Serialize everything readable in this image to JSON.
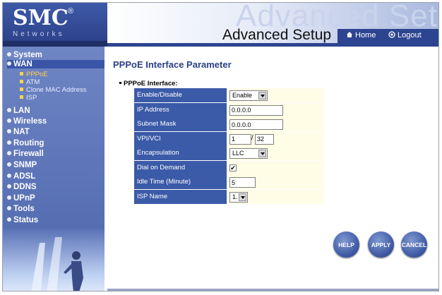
{
  "brand": {
    "logo": "SMC",
    "registered_mark": "®",
    "subtitle": "Networks"
  },
  "banner": {
    "ghost_text": "Advanced Setup",
    "title": "Advanced Setup",
    "home_label": "Home",
    "logout_label": "Logout"
  },
  "sidebar": {
    "items": [
      {
        "label": "System"
      },
      {
        "label": "WAN",
        "active": true
      },
      {
        "label": "LAN"
      },
      {
        "label": "Wireless"
      },
      {
        "label": "NAT"
      },
      {
        "label": "Routing"
      },
      {
        "label": "Firewall"
      },
      {
        "label": "SNMP"
      },
      {
        "label": "ADSL"
      },
      {
        "label": "DDNS"
      },
      {
        "label": "UPnP"
      },
      {
        "label": "Tools"
      },
      {
        "label": "Status"
      }
    ],
    "wan_subitems": [
      {
        "label": "PPPoE",
        "active": true
      },
      {
        "label": "ATM"
      },
      {
        "label": "Clone MAC Address"
      },
      {
        "label": "ISP"
      }
    ]
  },
  "main": {
    "page_title": "PPPoE Interface Parameter",
    "section_label": "PPPoE Interface:",
    "fields": {
      "enable_disable": {
        "label": "Enable/Disable",
        "value": "Enable"
      },
      "ip_address": {
        "label": "IP Address",
        "value": "0.0.0.0"
      },
      "subnet_mask": {
        "label": "Subnet Mask",
        "value": "0.0.0.0"
      },
      "vpi_vci": {
        "label": "VPI/VCI",
        "vpi": "1",
        "separator": "/",
        "vci": "32"
      },
      "encapsulation": {
        "label": "Encapsulation",
        "value": "LLC"
      },
      "dial_on_demand": {
        "label": "Dial on Demand",
        "checked": true,
        "mark": "✔"
      },
      "idle_time": {
        "label": "Idle Time (Minute)",
        "value": "5"
      },
      "isp_name": {
        "label": "ISP Name",
        "value": "1."
      }
    },
    "buttons": {
      "help": "HELP",
      "apply": "APPLY",
      "cancel": "CANCEL"
    }
  },
  "colors": {
    "accent": "#3b5aa7",
    "sidebar": "#5a72b6",
    "value_cell": "#fffde6",
    "active_subitem": "#ffd24a"
  }
}
